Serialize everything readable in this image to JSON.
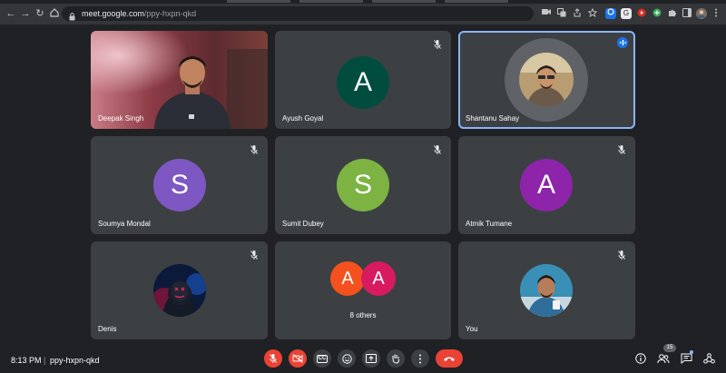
{
  "browser": {
    "url_host": "meet.google.com",
    "url_path": "/ppy-hxpn-qkd",
    "extension_labels": [
      "G"
    ]
  },
  "participants": [
    {
      "name": "Deepak Singh",
      "type": "video"
    },
    {
      "name": "Ayush Goyal",
      "initial": "A",
      "color": "#004d40",
      "muted": true
    },
    {
      "name": "Shantanu Sahay",
      "type": "photo",
      "speaking": true
    },
    {
      "name": "Soumya Mondal",
      "initial": "S",
      "color": "#7e57c2",
      "muted": true
    },
    {
      "name": "Sumit Dubey",
      "initial": "S",
      "color": "#7cb342",
      "muted": true
    },
    {
      "name": "Atmik Tumane",
      "initial": "A",
      "color": "#8e24aa",
      "muted": true
    },
    {
      "name": "Denis",
      "type": "photo",
      "muted": true
    },
    {
      "others_label": "8 others",
      "initials": [
        "A",
        "A"
      ],
      "colors": [
        "#f4511e",
        "#d81b60"
      ]
    },
    {
      "name": "You",
      "type": "photo",
      "muted": true
    }
  ],
  "meeting": {
    "time": "8:13 PM",
    "separator": "|",
    "code": "ppy-hxpn-qkd",
    "people_count": "15"
  },
  "colors": {
    "background": "#202124",
    "tile": "#3c4043",
    "accent": "#8ab4f8",
    "danger": "#ea4335"
  },
  "icons": {
    "mic": "mic-off-icon",
    "camera": "camera-off-icon",
    "captions": "captions-icon",
    "emoji": "emoji-icon",
    "present": "present-icon",
    "hand": "raise-hand-icon",
    "more": "more-options-icon",
    "hangup": "hangup-icon",
    "info": "info-icon",
    "people": "people-icon",
    "chat": "chat-icon",
    "activities": "activities-icon"
  }
}
